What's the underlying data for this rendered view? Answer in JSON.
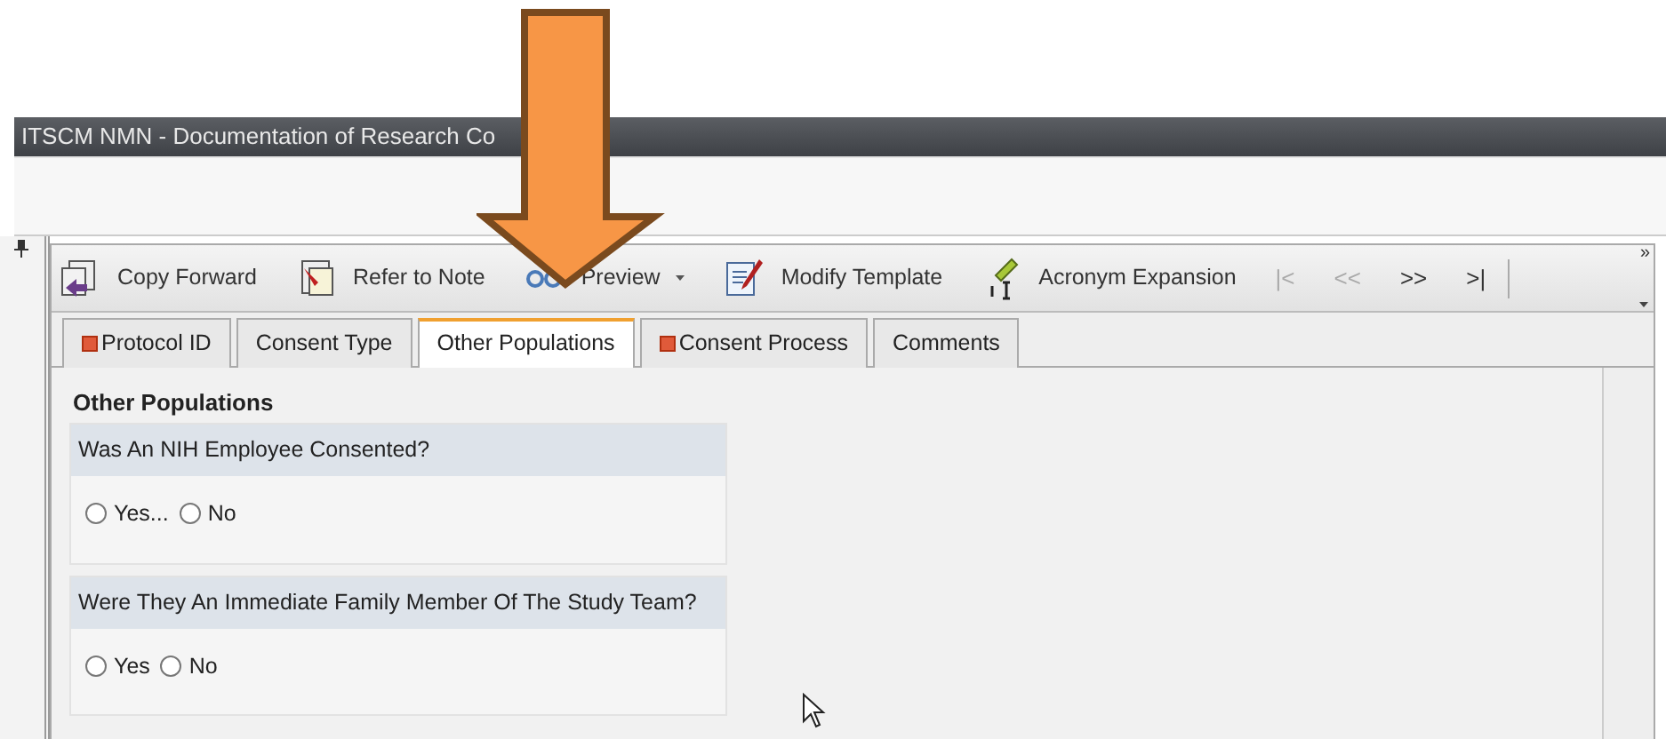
{
  "window": {
    "title": "ITSCM NMN - Documentation of Research Co"
  },
  "toolbar": {
    "items": [
      {
        "label": "Copy Forward",
        "kind": "copy"
      },
      {
        "label": "Refer to Note",
        "kind": "refer"
      },
      {
        "label": "Preview",
        "kind": "preview"
      },
      {
        "label": "Modify Template",
        "kind": "modify"
      },
      {
        "label": "Acronym Expansion",
        "kind": "acronym"
      }
    ],
    "nav": [
      {
        "label": "|<",
        "disabled": true
      },
      {
        "label": "<<",
        "disabled": true
      },
      {
        "label": ">>",
        "disabled": false
      },
      {
        "label": ">|",
        "disabled": false
      }
    ],
    "overflow": "»"
  },
  "tabs": [
    {
      "label": "Protocol ID",
      "selected": false,
      "flagged": true
    },
    {
      "label": "Consent Type",
      "selected": false,
      "flagged": false
    },
    {
      "label": "Other Populations",
      "selected": true,
      "flagged": false
    },
    {
      "label": "Consent Process",
      "selected": false,
      "flagged": true
    },
    {
      "label": "Comments",
      "selected": false,
      "flagged": false
    }
  ],
  "section": {
    "title": "Other Populations",
    "questions": [
      {
        "text": "Was An NIH Employee Consented?",
        "options": [
          {
            "label": "Yes...",
            "selected": false
          },
          {
            "label": "No",
            "selected": false
          }
        ]
      },
      {
        "text": "Were They An Immediate Family Member Of The Study Team?",
        "options": [
          {
            "label": "Yes",
            "selected": false
          },
          {
            "label": "No",
            "selected": false
          }
        ]
      }
    ]
  }
}
